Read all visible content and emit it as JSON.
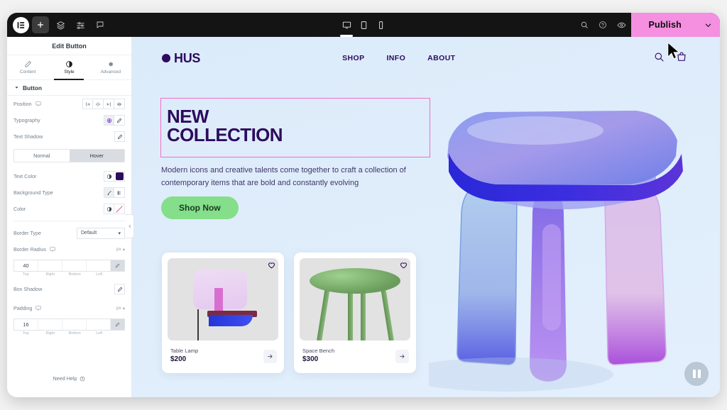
{
  "colors": {
    "accent_pink": "#f58fe0",
    "button_green": "#84de8a",
    "brand_purple": "#2d0b5e",
    "selection_pink": "#f06fc8"
  },
  "topbar": {
    "logo_icon": "elementor-logo-icon",
    "buttons": [
      {
        "name": "add-element-button",
        "icon": "plus-icon"
      },
      {
        "name": "structure-button",
        "icon": "layers-icon"
      },
      {
        "name": "site-settings-button",
        "icon": "sliders-icon"
      },
      {
        "name": "comments-button",
        "icon": "comment-icon"
      }
    ],
    "device_modes": [
      {
        "name": "desktop",
        "icon": "desktop-icon",
        "active": true
      },
      {
        "name": "tablet",
        "icon": "tablet-icon",
        "active": false
      },
      {
        "name": "mobile",
        "icon": "mobile-icon",
        "active": false
      }
    ],
    "right_buttons": [
      {
        "name": "finder-button",
        "icon": "search-icon"
      },
      {
        "name": "help-button",
        "icon": "question-circle-icon"
      },
      {
        "name": "preview-button",
        "icon": "eye-icon"
      }
    ],
    "publish_label": "Publish",
    "publish_caret_icon": "chevron-down-icon"
  },
  "panel": {
    "title": "Edit Button",
    "tabs": [
      {
        "label": "Content",
        "icon": "pencil-icon",
        "active": false
      },
      {
        "label": "Style",
        "icon": "contrast-icon",
        "active": true
      },
      {
        "label": "Advanced",
        "icon": "gear-icon",
        "active": false
      }
    ],
    "section_label": "Button",
    "controls": {
      "position_label": "Position",
      "typography_label": "Typography",
      "text_shadow_label": "Text Shadow",
      "state_normal": "Normal",
      "state_hover": "Hover",
      "state_active": "Hover",
      "text_color_label": "Text Color",
      "text_color_value": "#2d0b5e",
      "background_type_label": "Background Type",
      "color_label": "Color",
      "border_type_label": "Border Type",
      "border_type_value": "Default",
      "border_radius_label": "Border Radius",
      "border_radius_unit": "px",
      "border_radius_values": [
        "40",
        "",
        "",
        ""
      ],
      "box_shadow_label": "Box Shadow",
      "padding_label": "Padding",
      "padding_unit": "px",
      "padding_values": [
        "16",
        "",
        "",
        ""
      ],
      "dim_labels": [
        "Top",
        "Right",
        "Bottom",
        "Left"
      ]
    },
    "need_help_label": "Need Help",
    "collapse_icon": "chevron-left-icon"
  },
  "site": {
    "brand": "HUS",
    "nav": [
      {
        "label": "SHOP"
      },
      {
        "label": "INFO"
      },
      {
        "label": "ABOUT"
      }
    ],
    "header_icons": [
      {
        "name": "search-icon"
      },
      {
        "name": "shopping-bag-icon"
      }
    ],
    "hero": {
      "title_line1": "NEW",
      "title_line2": "COLLECTION",
      "subtitle": "Modern icons and creative talents come together to craft a collection of contemporary items that are bold and constantly evolving",
      "cta_label": "Shop Now"
    },
    "products": [
      {
        "name": "Table Lamp",
        "price": "$200",
        "favorite_icon": "heart-icon",
        "arrow_icon": "arrow-right-icon"
      },
      {
        "name": "Space Bench",
        "price": "$300",
        "favorite_icon": "heart-icon",
        "arrow_icon": "arrow-right-icon"
      }
    ],
    "pause_button_icon": "pause-icon"
  }
}
